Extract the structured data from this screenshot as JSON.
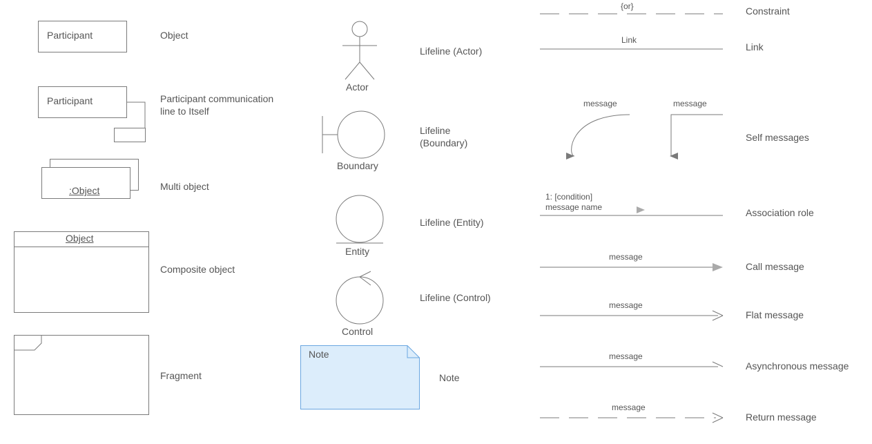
{
  "col1": {
    "participant_box1": "Participant",
    "object_label": "Object",
    "participant_box2": "Participant",
    "participant_comm_line1": "Participant communication",
    "participant_comm_line2": "line to Itself",
    "multi_object_text": ":Object",
    "multi_object_label": "Multi object",
    "composite_header": "Object",
    "composite_label": "Composite object",
    "fragment_label": "Fragment"
  },
  "col2": {
    "actor_caption": "Actor",
    "actor_label": "Lifeline (Actor)",
    "boundary_caption": "Boundary",
    "boundary_label1": "Lifeline",
    "boundary_label2": "(Boundary)",
    "entity_caption": "Entity",
    "entity_label": "Lifeline (Entity)",
    "control_caption": "Control",
    "control_label": "Lifeline (Control)",
    "note_text": "Note",
    "note_label": "Note"
  },
  "col3": {
    "constraint_text": "{or}",
    "constraint_label": "Constraint",
    "link_text": "Link",
    "link_label": "Link",
    "self_msg1": "message",
    "self_msg2": "message",
    "self_label": "Self messages",
    "assoc_line1": "1: [condition]",
    "assoc_line2": "message name",
    "assoc_label": "Association role",
    "call_text": "message",
    "call_label": "Call message",
    "flat_text": "message",
    "flat_label": "Flat message",
    "async_text": "message",
    "async_label": "Asynchronous message",
    "return_text": "message",
    "return_label": "Return message"
  }
}
